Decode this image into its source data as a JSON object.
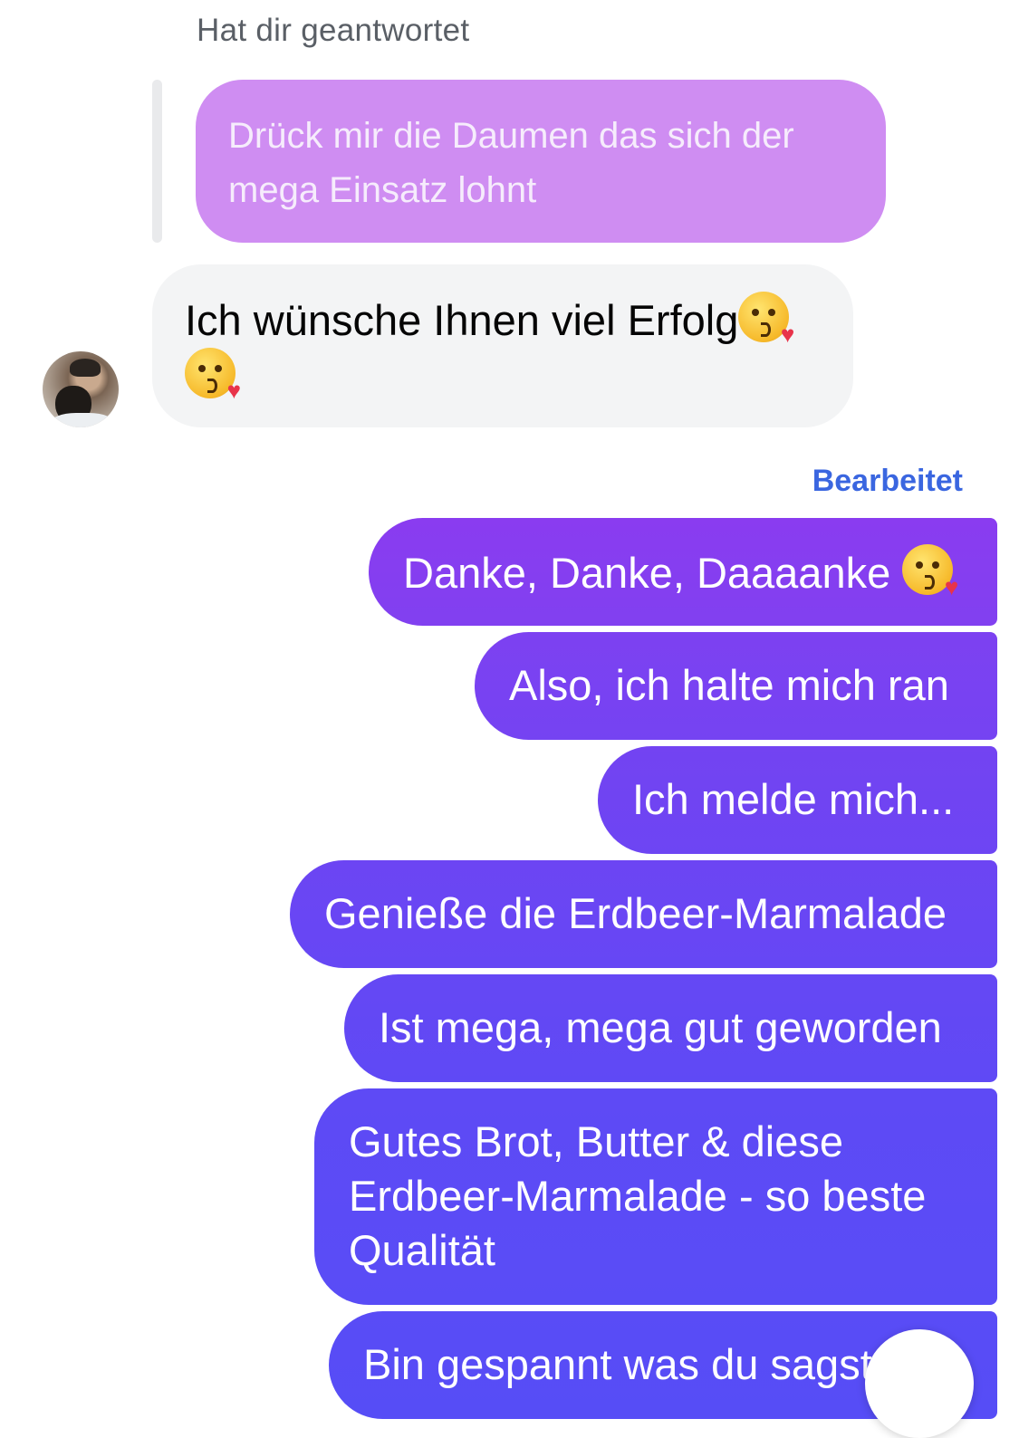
{
  "reply_label": "Hat dir geantwortet",
  "quoted_message": "Drück mir die Daumen das sich der mega Einsatz lohnt",
  "incoming_message": "Ich wünsche Ihnen viel Erfolg",
  "edited_label": "Bearbeitet",
  "outgoing": [
    {
      "text": "Danke, Danke, Daaaanke"
    },
    {
      "text": "Also, ich halte mich ran"
    },
    {
      "text": "Ich melde mich..."
    },
    {
      "text": "Genieße die Erdbeer-Marmalade"
    },
    {
      "text": "Ist mega, mega gut geworden"
    },
    {
      "text": "Gutes Brot, Butter & diese Erdbeer-Marmalade - so beste Qualität"
    },
    {
      "text": "Bin gespannt was du sagst"
    }
  ],
  "icons": {
    "emoji": "face-blowing-kiss-icon",
    "avatar": "contact-avatar"
  },
  "colors": {
    "quoted_bubble": "#cf8df2",
    "incoming_bubble": "#f3f4f5",
    "outgoing_gradient_top": "#8a3cf0",
    "outgoing_gradient_bottom": "#5a4cf6",
    "edited_label": "#3a66e0"
  }
}
